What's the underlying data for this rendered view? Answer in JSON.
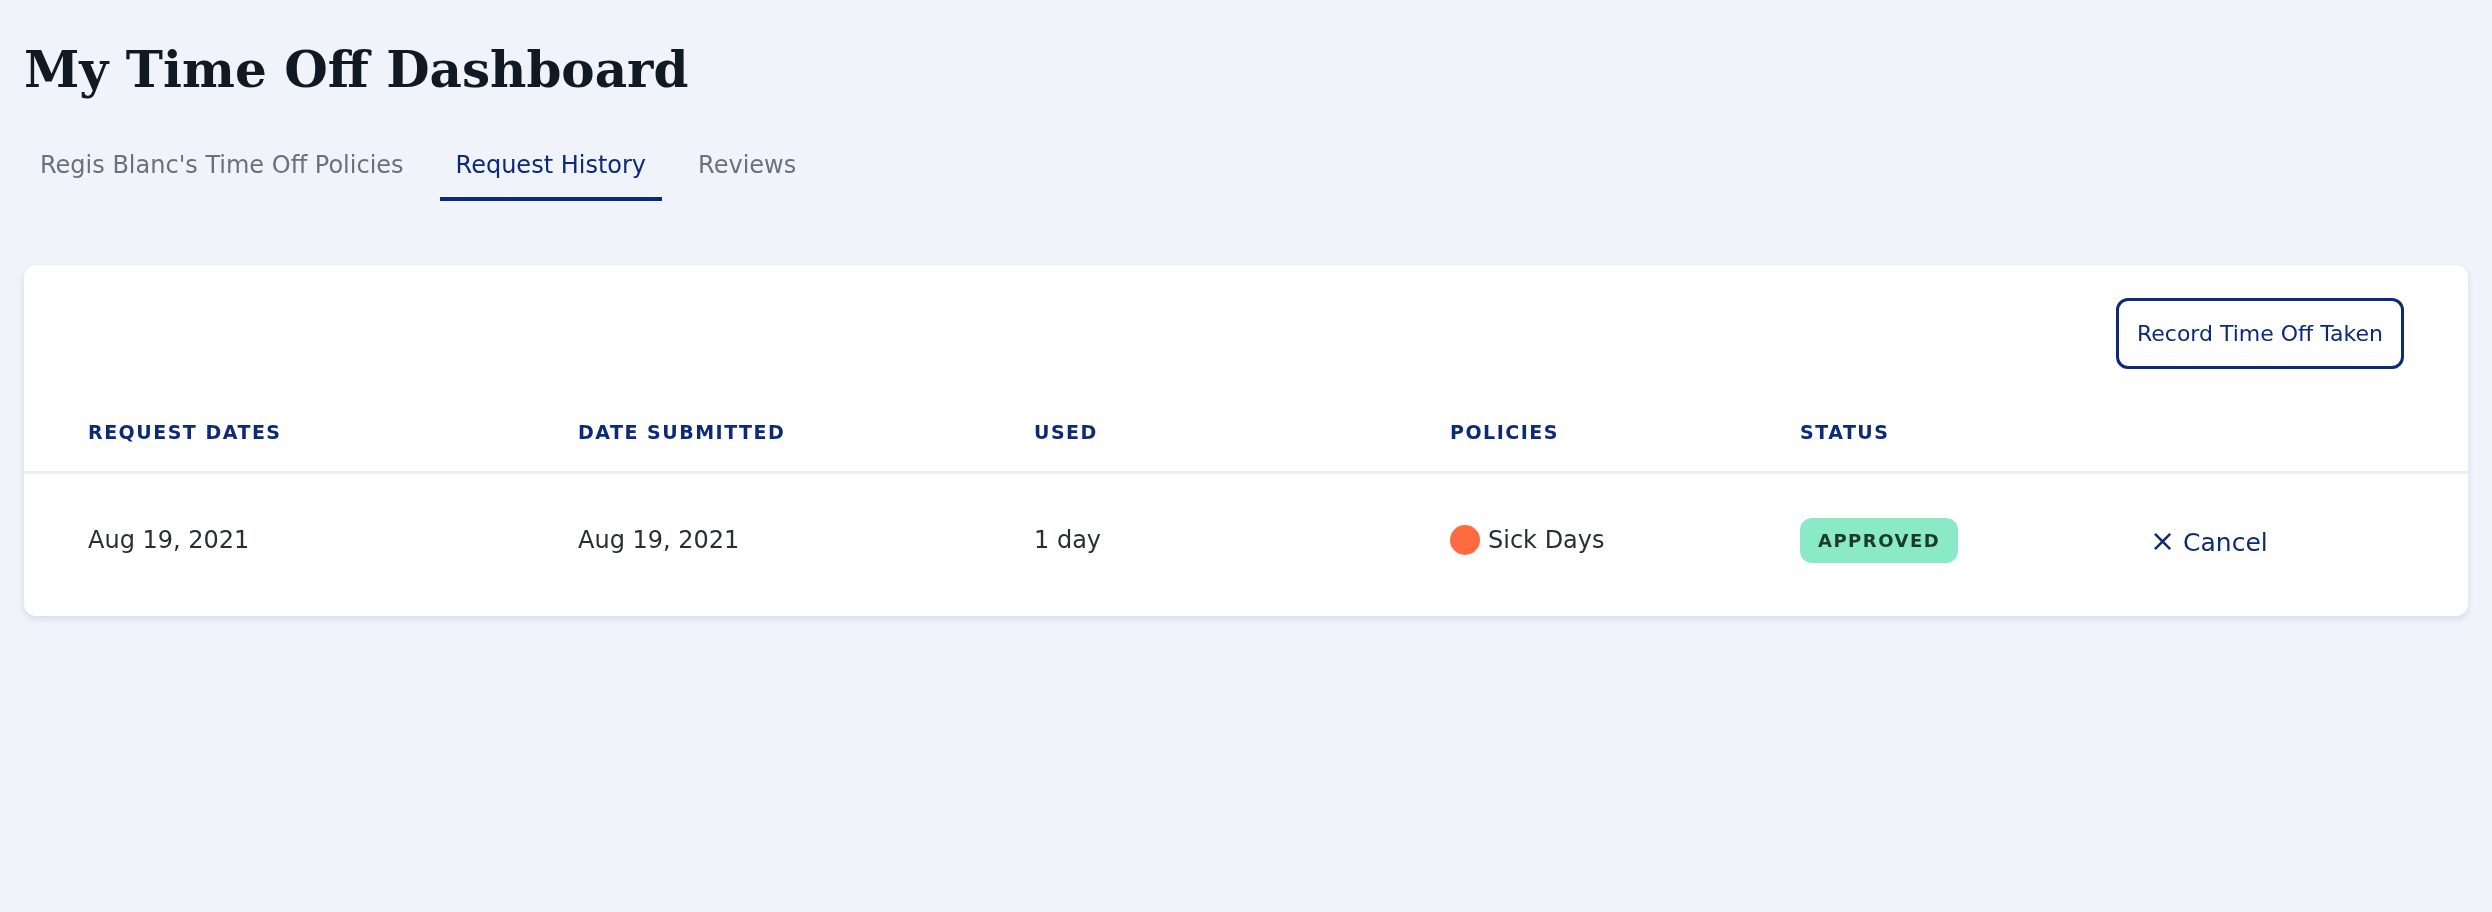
{
  "page": {
    "title": "My Time Off Dashboard"
  },
  "tabs": [
    {
      "label": "Regis Blanc's Time Off Policies",
      "selected": false
    },
    {
      "label": "Request History",
      "selected": true
    },
    {
      "label": "Reviews",
      "selected": false
    }
  ],
  "actions": {
    "record_button": "Record Time Off Taken"
  },
  "table": {
    "columns": [
      "REQUEST DATES",
      "DATE SUBMITTED",
      "USED",
      "POLICIES",
      "STATUS"
    ],
    "rows": [
      {
        "request_dates": "Aug 19, 2021",
        "date_submitted": "Aug 19, 2021",
        "used": "1 day",
        "policy": {
          "name": "Sick Days",
          "color": "#ff6b40"
        },
        "status": {
          "label": "APPROVED",
          "kind": "approved"
        },
        "action": {
          "icon": "×",
          "label": "Cancel"
        }
      }
    ]
  }
}
